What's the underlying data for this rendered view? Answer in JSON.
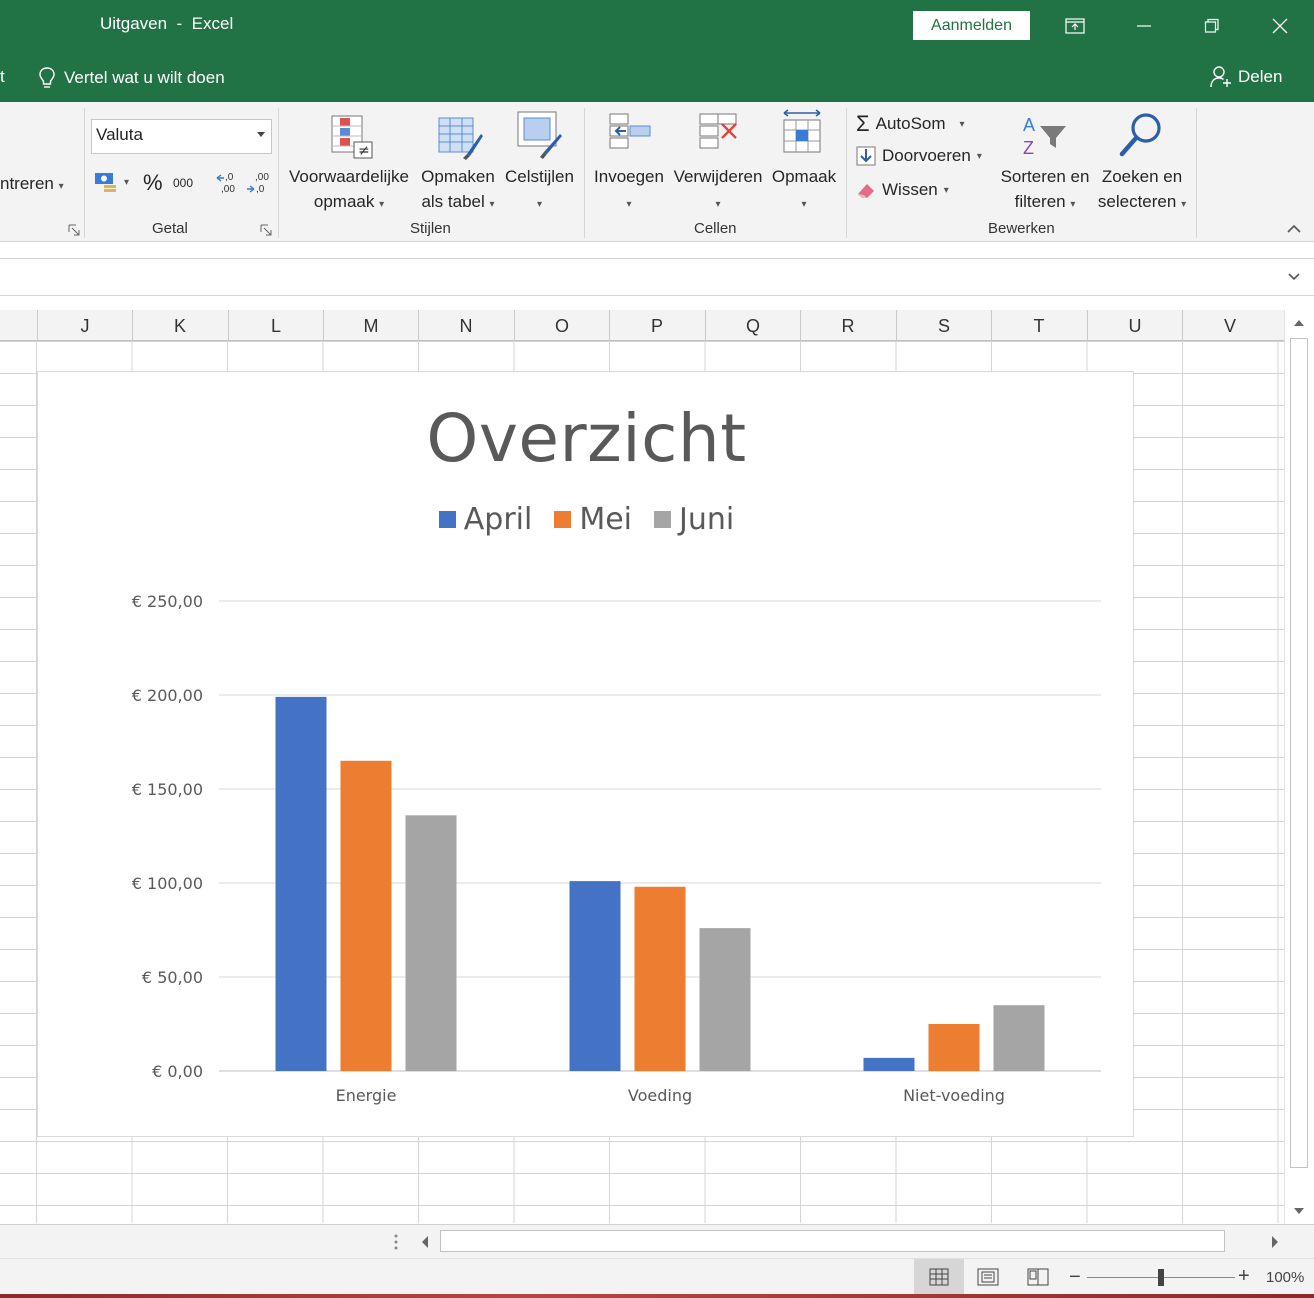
{
  "window": {
    "title": "Uitgaven  -  Excel",
    "signin_label": "Aanmelden"
  },
  "tellbar": {
    "tab_partial": "t",
    "tellme": "Vertel wat u wilt doen",
    "share": "Delen"
  },
  "ribbon": {
    "align_partial": "ntreren",
    "number_format": "Valuta",
    "groups": {
      "getal": "Getal",
      "stijlen": "Stijlen",
      "cellen": "Cellen",
      "bewerken": "Bewerken"
    },
    "buttons": {
      "percent": "%",
      "thousands": "000",
      "cond_format_1": "Voorwaardelijke",
      "cond_format_2": "opmaak",
      "as_table_1": "Opmaken",
      "as_table_2": "als tabel",
      "cell_styles": "Celstijlen",
      "insert": "Invoegen",
      "delete": "Verwijderen",
      "format": "Opmaak",
      "autosum": "AutoSom",
      "fill": "Doorvoeren",
      "clear": "Wissen",
      "sort_1": "Sorteren en",
      "sort_2": "filteren",
      "find_1": "Zoeken en",
      "find_2": "selecteren"
    }
  },
  "columns": [
    "J",
    "K",
    "L",
    "M",
    "N",
    "O",
    "P",
    "Q",
    "R",
    "S",
    "T",
    "U",
    "V"
  ],
  "status": {
    "zoom": "100%"
  },
  "chart_data": {
    "type": "bar",
    "title": "Overzicht",
    "categories": [
      "Energie",
      "Voeding",
      "Niet-voeding"
    ],
    "series": [
      {
        "name": "April",
        "color": "#4472C4",
        "values": [
          199,
          101,
          7
        ]
      },
      {
        "name": "Mei",
        "color": "#ED7D31",
        "values": [
          165,
          98,
          25
        ]
      },
      {
        "name": "Juni",
        "color": "#A5A5A5",
        "values": [
          136,
          76,
          35
        ]
      }
    ],
    "ylim": [
      0,
      250
    ],
    "yticks": [
      0,
      50,
      100,
      150,
      200,
      250
    ],
    "ytick_labels": [
      "€ 0,00",
      "€ 50,00",
      "€ 100,00",
      "€ 150,00",
      "€ 200,00",
      "€ 250,00"
    ],
    "grid": true,
    "legend_position": "top"
  }
}
